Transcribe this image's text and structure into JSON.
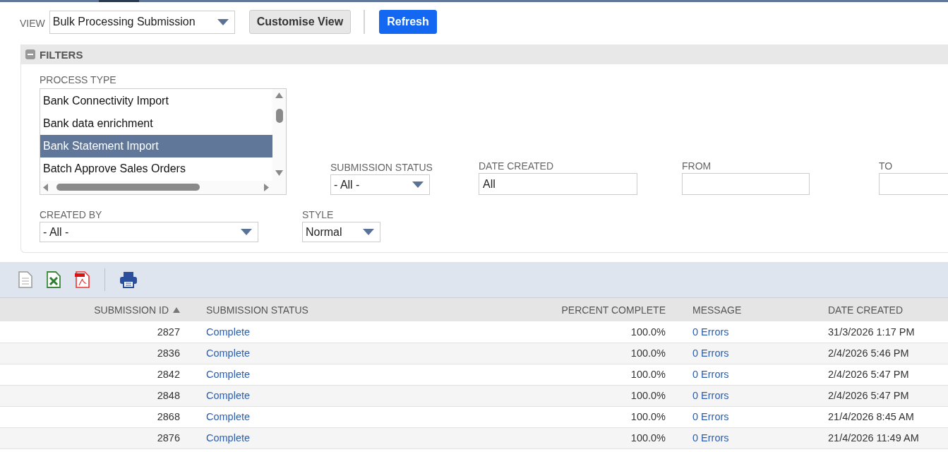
{
  "view": {
    "label": "VIEW",
    "value": "Bulk Processing Submission"
  },
  "buttons": [
    {
      "label": "Customise View",
      "kind": "secondary"
    },
    {
      "label": "Refresh",
      "kind": "primary"
    }
  ],
  "filters": {
    "title": "FILTERS",
    "expanded": true,
    "process_type": {
      "label": "PROCESS TYPE",
      "items": [
        {
          "label": "Bank Connectivity Import",
          "selected": false
        },
        {
          "label": "Bank data enrichment",
          "selected": false
        },
        {
          "label": "Bank Statement Import",
          "selected": true
        },
        {
          "label": "Batch Approve Sales Orders",
          "selected": false
        }
      ]
    },
    "fields": [
      {
        "label": "SUBMISSION STATUS",
        "kind": "select",
        "value": "- All -"
      },
      {
        "label": "DATE CREATED",
        "kind": "text",
        "value": "All"
      },
      {
        "label": "FROM",
        "kind": "text"
      },
      {
        "label": "TO",
        "kind": "text"
      }
    ],
    "fields_2": [
      {
        "label": "CREATED BY",
        "kind": "select",
        "value": "- All -"
      },
      {
        "label": "STYLE",
        "kind": "select",
        "value": "Normal"
      }
    ]
  },
  "table": {
    "columns": [
      {
        "label": "SUBMISSION ID",
        "kind": "number",
        "sort_ascending": true
      },
      {
        "label": "SUBMISSION STATUS",
        "kind": "link",
        "sort_ascending": false
      },
      {
        "label": "PERCENT COMPLETE",
        "kind": "number",
        "sort_ascending": false
      },
      {
        "label": "MESSAGE",
        "kind": "link",
        "sort_ascending": false
      },
      {
        "label": "DATE CREATED",
        "kind": "text",
        "sort_ascending": false
      }
    ],
    "rows": [
      [
        "2827",
        "Complete",
        "100.0%",
        "0 Errors",
        "31/3/2026 1:17 PM"
      ],
      [
        "2836",
        "Complete",
        "100.0%",
        "0 Errors",
        "2/4/2026 5:46 PM"
      ],
      [
        "2842",
        "Complete",
        "100.0%",
        "0 Errors",
        "2/4/2026 5:47 PM"
      ],
      [
        "2848",
        "Complete",
        "100.0%",
        "0 Errors",
        "2/4/2026 5:47 PM"
      ],
      [
        "2868",
        "Complete",
        "100.0%",
        "0 Errors",
        "21/4/2026 8:45 AM"
      ],
      [
        "2876",
        "Complete",
        "100.0%",
        "0 Errors",
        "21/4/2026 11:49 AM"
      ]
    ]
  }
}
